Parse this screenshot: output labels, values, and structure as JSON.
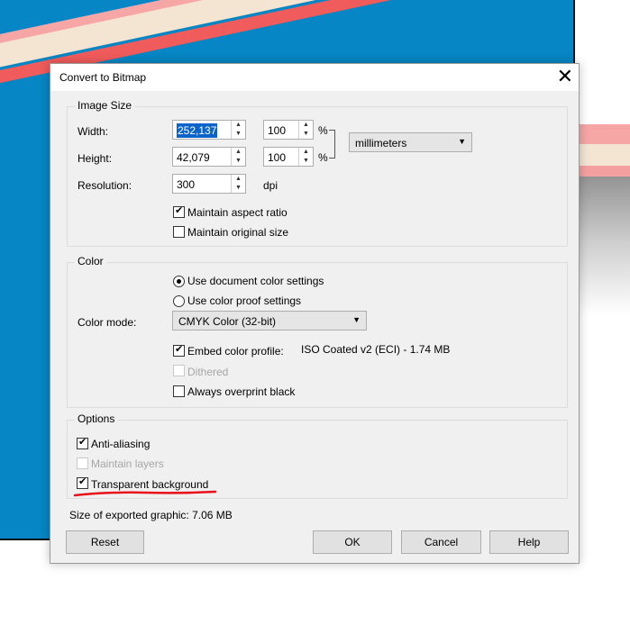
{
  "dialog": {
    "title": "Convert to Bitmap",
    "close_symbol": "✕"
  },
  "image_size": {
    "legend": "Image Size",
    "width_label": "Width:",
    "width_value": "252,137",
    "width_percent": "100",
    "height_label": "Height:",
    "height_value": "42,079",
    "height_percent": "100",
    "percent_symbol": "%",
    "resolution_label": "Resolution:",
    "resolution_value": "300",
    "resolution_unit": "dpi",
    "units_selected": "millimeters",
    "maintain_aspect_ratio": {
      "label": "Maintain aspect ratio",
      "checked": true
    },
    "maintain_original_size": {
      "label": "Maintain original size",
      "checked": false
    }
  },
  "color": {
    "legend": "Color",
    "use_document_color_settings": {
      "label": "Use document color settings",
      "selected": true
    },
    "use_color_proof_settings": {
      "label": "Use color proof settings",
      "selected": false
    },
    "color_mode_label": "Color mode:",
    "color_mode_selected": "CMYK Color (32-bit)",
    "embed_color_profile": {
      "label": "Embed color profile:",
      "checked": true
    },
    "profile_name": "ISO Coated v2 (ECI) - 1.74 MB",
    "dithered": {
      "label": "Dithered",
      "checked": false,
      "enabled": false
    },
    "always_overprint_black": {
      "label": "Always overprint black",
      "checked": false
    }
  },
  "options": {
    "legend": "Options",
    "anti_aliasing": {
      "label": "Anti-aliasing",
      "checked": true
    },
    "maintain_layers": {
      "label": "Maintain layers",
      "checked": false,
      "enabled": false
    },
    "transparent_background": {
      "label": "Transparent background",
      "checked": true
    }
  },
  "export_size_text": "Size of exported graphic: 7.06 MB",
  "buttons": {
    "reset": "Reset",
    "ok": "OK",
    "cancel": "Cancel",
    "help": "Help"
  },
  "annotation": {
    "underline_color": "#e8101a"
  },
  "colors": {
    "background_blue": "#0686c4",
    "selection_blue": "#0a64c9"
  }
}
